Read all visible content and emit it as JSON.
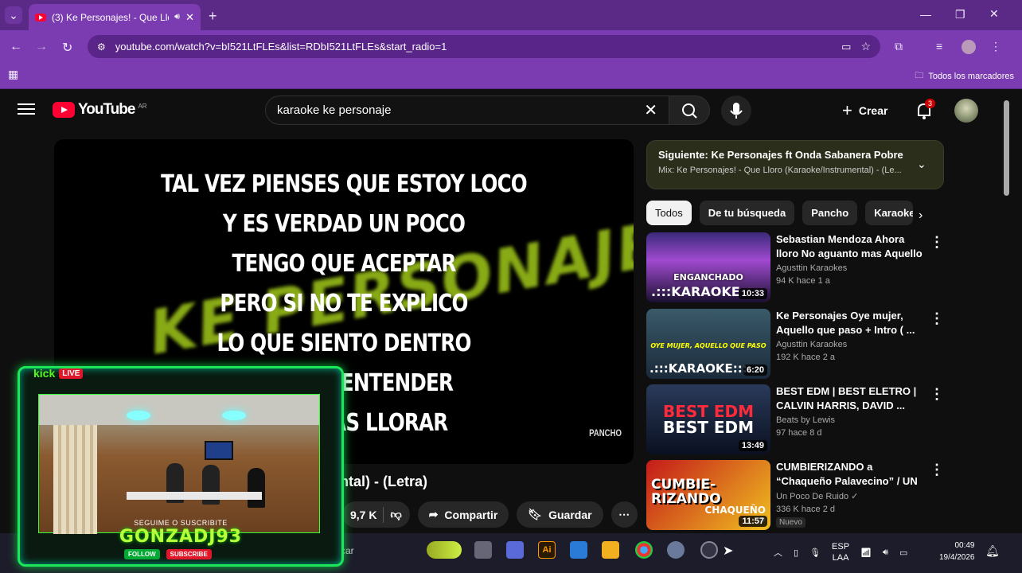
{
  "browser": {
    "tab_title": "(3) Ke Personajes! - Que Llo",
    "url": "youtube.com/watch?v=bI521LtFLEs&list=RDbI521LtFLEs&start_radio=1",
    "bookmarks_label": "Todos los marcadores"
  },
  "youtube": {
    "logo_text": "YouTube",
    "country_code": "AR",
    "search_query": "karaoke ke personaje",
    "create_label": "Crear",
    "notification_count": "3"
  },
  "player": {
    "brand_overlay": "KE PERSONAJES",
    "lyrics": [
      "TAL VEZ PIENSES QUE ESTOY LOCO",
      "Y ES VERDAD UN POCO",
      "TENGO QUE ACEPTAR",
      "PERO SI NO TE EXPLICO",
      "LO QUE SIENTO DENTRO",
      "NO VAS A ENTENDER",
      "SI ME VEAS LLORAR"
    ],
    "watermark": "PANCHO"
  },
  "video": {
    "title_visible": "st   mental) - (Letra)",
    "like_count": "9,7 K",
    "share_label": "Compartir",
    "save_label": "Guardar"
  },
  "up_next": {
    "line1": "Siguiente: Ke Personajes ft Onda Sabanera Pobre c...",
    "line2": "Mix: Ke Personajes! - Que Lloro (Karaoke/Instrumental) - (Le..."
  },
  "chips": [
    "Todos",
    "De tu búsqueda",
    "Pancho",
    "Karaoke"
  ],
  "recommendations": [
    {
      "title": "Sebastian Mendoza Ahora lloro No aguanto mas Aquello que ...",
      "channel": "Agusttin Karaokes",
      "stats": "94 K  hace 1 a",
      "duration": "10:33",
      "thumb_text_1": "ENGANCHADO",
      "thumb_text_2": ".:::KARAOKE"
    },
    {
      "title": "Ke Personajes Oye mujer, Aquello que paso + Intro ( ...",
      "channel": "Agusttin Karaokes",
      "stats": "192 K  hace 2 a",
      "duration": "6:20",
      "thumb_text_1": "OYE MUJER, AQUELLO QUE PASO",
      "thumb_text_2": ".:::KARAOKE:::."
    },
    {
      "title": "BEST EDM | BEST ELETRO | CALVIN HARRIS, DAVID ...",
      "channel": "Beats by Lewis",
      "stats": "97  hace 8 d",
      "duration": "13:49",
      "thumb_text_1": "BEST EDM",
      "thumb_text_2": "BEST EDM"
    },
    {
      "title": "CUMBIERIZANDO a “Chaqueño Palavecino” / UN POCO DE ...",
      "channel": "Un Poco De Ruido",
      "stats": "336 K  hace 2 d",
      "duration": "11:57",
      "thumb_text_1": "CUMBIE-RIZANDO",
      "thumb_text_2": "CHAQUEÑO P",
      "badge": "Nuevo"
    }
  ],
  "stream_overlay": {
    "platform": "kick",
    "live_label": "LIVE",
    "cta": "SEGUIME O SUSCRIBITE",
    "nick": "GONZADJ93",
    "follow_label": "FOLLOW",
    "subscribe_label": "SUBSCRIBE"
  },
  "taskbar": {
    "search_partial": "car",
    "lang_1": "ESP",
    "lang_2": "LAA",
    "time": "00:49",
    "date": "19/4/2026"
  },
  "colors": {
    "browser_frame": "#7a3cb0",
    "youtube_red": "#ff0033",
    "kick_green": "#53fc18",
    "lyrics_brand": "#b6e31d"
  }
}
